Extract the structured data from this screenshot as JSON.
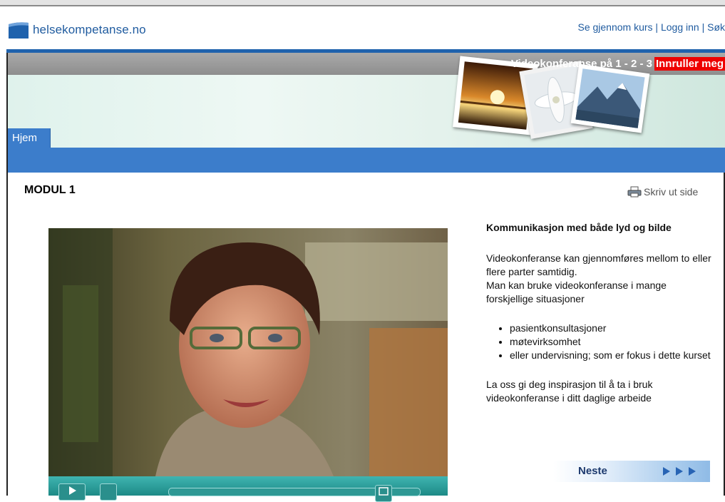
{
  "header": {
    "logo_text": "helsekompetanse.no",
    "links": [
      "Se gjennom kurs",
      "Logg inn",
      "Søk"
    ]
  },
  "banner": {
    "promo_text": "Videokonferanse på 1 - 2 - 3",
    "enroll_label": "Innruller meg"
  },
  "nav": {
    "tabs": [
      "Hjem"
    ]
  },
  "main": {
    "module_title": "MODUL 1",
    "print_label": "Skriv ut side"
  },
  "side": {
    "heading": "Kommunikasjon med både lyd og bilde",
    "paragraph1": "Videokonferanse kan gjennomføres mellom to eller flere parter samtidig.",
    "paragraph2": "Man kan bruke videokonferanse i mange forskjellige situasjoner",
    "bullets": [
      "pasientkonsultasjoner",
      "møtevirksomhet",
      "eller undervisning; som er fokus i dette kurset"
    ],
    "paragraph3": "La oss gi deg inspirasjon til å ta i bruk videokonferanse i ditt daglige arbeide",
    "next_label": "Neste"
  },
  "colors": {
    "brand_blue": "#1f62ad",
    "nav_blue": "#3c7dcb",
    "enroll_red": "#ee0000",
    "player_teal": "#1d8a86"
  }
}
